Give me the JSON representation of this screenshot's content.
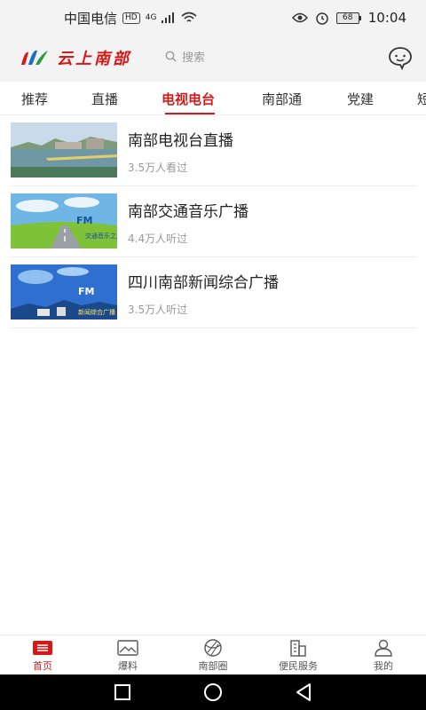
{
  "status_bar": {
    "carrier": "中国电信",
    "hd": "HD",
    "network": "4G",
    "battery": "68",
    "time": "10:04"
  },
  "header": {
    "logo_text": "云上南部",
    "search_placeholder": "搜索",
    "chat_icon": "chat-bubble-icon"
  },
  "tabs": [
    {
      "label": "推荐"
    },
    {
      "label": "直播"
    },
    {
      "label": "电视电台",
      "active": true
    },
    {
      "label": "南部通"
    },
    {
      "label": "党建"
    },
    {
      "label": "短"
    }
  ],
  "items": [
    {
      "title": "南部电视台直播",
      "meta": "3.5万人看过"
    },
    {
      "title": "南部交通音乐广播",
      "meta": "4.4万人听过",
      "thumb_text": "FM",
      "thumb_subtext": "交通音乐之声"
    },
    {
      "title": "四川南部新闻综合广播",
      "meta": "3.5万人听过",
      "thumb_text": "FM",
      "thumb_subtext": "新闻综合广播"
    }
  ],
  "bottom_nav": [
    {
      "label": "首页",
      "icon": "home-icon",
      "active": true
    },
    {
      "label": "爆料",
      "icon": "image-icon"
    },
    {
      "label": "南部圈",
      "icon": "circle-icon"
    },
    {
      "label": "便民服务",
      "icon": "building-icon"
    },
    {
      "label": "我的",
      "icon": "person-icon"
    }
  ],
  "colors": {
    "accent": "#d21a1a",
    "header_bg": "#f3f3f3"
  }
}
